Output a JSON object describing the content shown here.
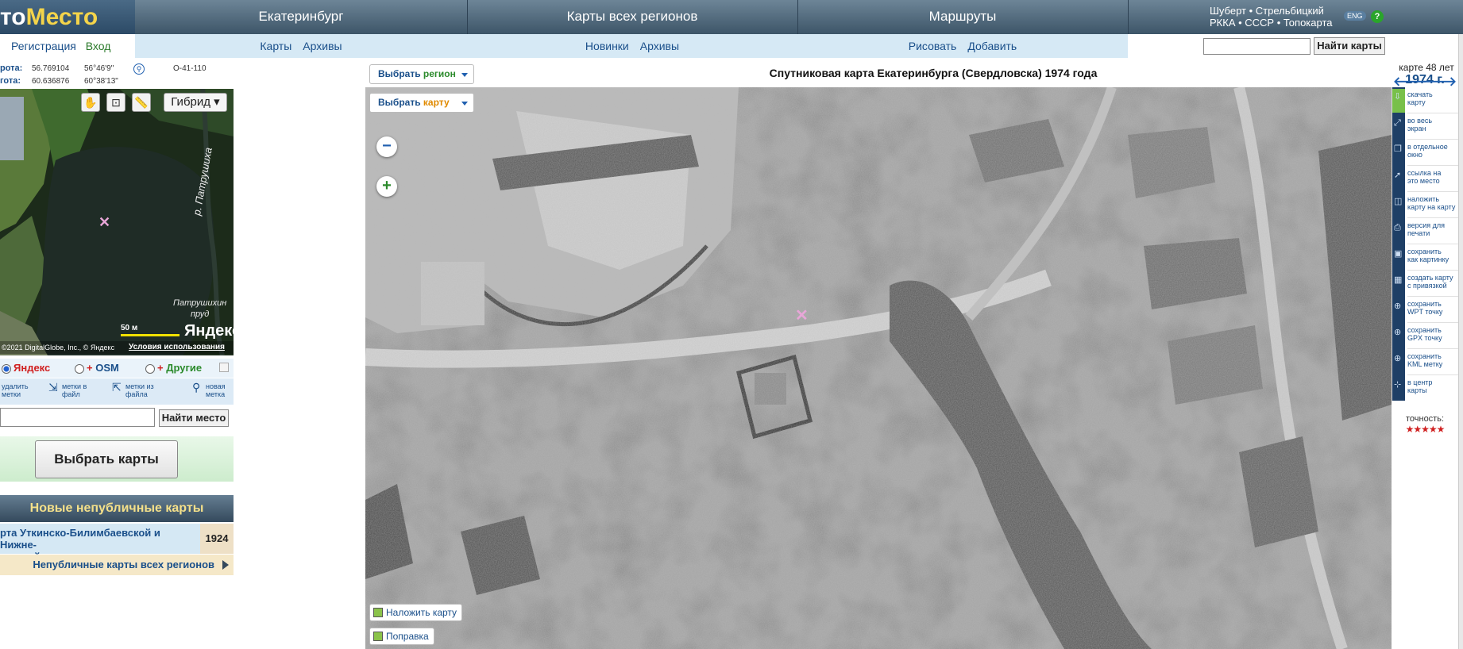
{
  "header": {
    "logo_prefix": "",
    "logo_a": "то",
    "logo_b": "Место",
    "cells": [
      "Екатеринбург",
      "Карты всех регионов",
      "Маршруты"
    ],
    "right_line1": "Шуберт • Стрельбицкий",
    "right_line2": "РККА • СССР • Топокарта",
    "eng": "ENG",
    "help": "?"
  },
  "subnav": {
    "register": "Регистрация",
    "login": "Вход",
    "group1": [
      "Карты",
      "Архивы"
    ],
    "group2": [
      "Новинки",
      "Архивы"
    ],
    "group3": [
      "Рисовать",
      "Добавить"
    ],
    "search_value": "",
    "search_button": "Найти карты"
  },
  "coords": {
    "lat_label": "рота:",
    "lat_dec": "56.769104",
    "lat_dms": "56°46'9\"",
    "lon_label": "гота:",
    "lon_dec": "60.636876",
    "lon_dms": "60°38'13\"",
    "sheet": "O-41-110"
  },
  "minimap": {
    "type_label": "Гибрид ▾",
    "river": "р. Патрушиха",
    "pond_line1": "Патрушихин",
    "pond_line2": "пруд",
    "scale": "50 м",
    "brand": "Яндекс",
    "copyright": "©2021 DigitalGlobe, Inc., © Яндекс",
    "terms": "Условия использования"
  },
  "sources": {
    "yandex": "Яндекс",
    "osm": "OSM",
    "others": "Другие",
    "plus": "+"
  },
  "tools": [
    {
      "l1": "удалить",
      "l2": "метки"
    },
    {
      "l1": "метки в",
      "l2": "файл"
    },
    {
      "l1": "метки из",
      "l2": "файла"
    },
    {
      "l1": "новая",
      "l2": "метка"
    }
  ],
  "place_search": {
    "value": "",
    "button": "Найти место"
  },
  "choose_maps": "Выбрать карты",
  "new_maps": {
    "title": "Новые непубличные карты",
    "item_line1": "рта Уткинско-Билимбаевской и Нижне-",
    "item_line2": "гинской дач",
    "item_year": "1924",
    "all_link": "Непубличные карты всех регионов"
  },
  "map": {
    "title": "Спутниковая карта Екатеринбурга (Свердловска) 1974 года",
    "select_region_a": "Выбрать ",
    "select_region_b": "регион",
    "select_map_a": "Выбрать ",
    "select_map_b": "карту",
    "overlay_btn": "Наложить карту",
    "fix_btn": "Поправка",
    "zoom_out": "−",
    "zoom_in": "+"
  },
  "right_panel": {
    "age": "карте 48 лет",
    "year": "1974 г.",
    "items": [
      {
        "l1": "скачать",
        "l2": "карту"
      },
      {
        "l1": "во весь",
        "l2": "экран"
      },
      {
        "l1": "в отдельное",
        "l2": "окно"
      },
      {
        "l1": "ссылка на",
        "l2": "это место"
      },
      {
        "l1": "наложить",
        "l2": "карту на карту"
      },
      {
        "l1": "версия для",
        "l2": "печати"
      },
      {
        "l1": "сохранить",
        "l2": "как картинку"
      },
      {
        "l1": "создать карту",
        "l2": "с привязкой"
      },
      {
        "l1": "сохранить",
        "l2": "WPT точку"
      },
      {
        "l1": "сохранить",
        "l2": "GPX точку"
      },
      {
        "l1": "сохранить",
        "l2": "KML метку"
      },
      {
        "l1": "в центр",
        "l2": "карты"
      }
    ],
    "accuracy_label": "точность:",
    "accuracy_stars": "★★★★★"
  },
  "colors": {
    "header_bg": "#3d5568",
    "subnav_bg": "#d6e9f5",
    "link": "#1a4f8a",
    "accent_green": "#2b8a2b",
    "accent_gold": "#f4d44a"
  }
}
